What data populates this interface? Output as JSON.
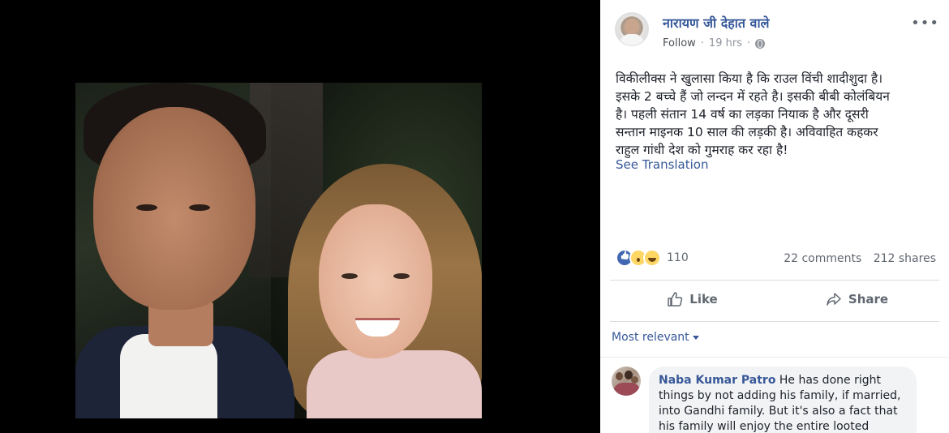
{
  "post": {
    "author": "नारायण जी देहात वाले",
    "follow_label": "Follow",
    "time": "19 hrs",
    "more_label": "•••",
    "text": "विकीलीक्स ने खुलासा किया है कि राउल विंची शादीशुदा है।\nइसके 2 बच्चे हैं जो लन्दन में रहते है। इसकी बीबी कोलंबियन\nहै। पहली संतान 14 वर्ष का लड़का नियाक है और दूसरी\nसन्तान माइनक 10 साल की लड़की है। अविवाहित कहकर\nराहुल गांधी देश को गुमराह कर रहा है!",
    "see_translation": "See Translation"
  },
  "stats": {
    "reaction_icons": [
      "like-icon",
      "wow-icon",
      "haha-icon"
    ],
    "reaction_count": "110",
    "comments": "22 comments",
    "shares": "212 shares"
  },
  "actions": {
    "like_label": "Like",
    "share_label": "Share"
  },
  "comments": {
    "sort_label": "Most relevant",
    "items": [
      {
        "name": "Naba Kumar Patro",
        "text": "He has done right things by not adding his family, if married, into Gandhi family. But it's also a fact that his family will enjoy the entire looted money"
      }
    ]
  },
  "colors": {
    "link": "#365899",
    "muted": "#90949c",
    "divider": "#dadde1",
    "bubble": "#f2f3f5"
  }
}
